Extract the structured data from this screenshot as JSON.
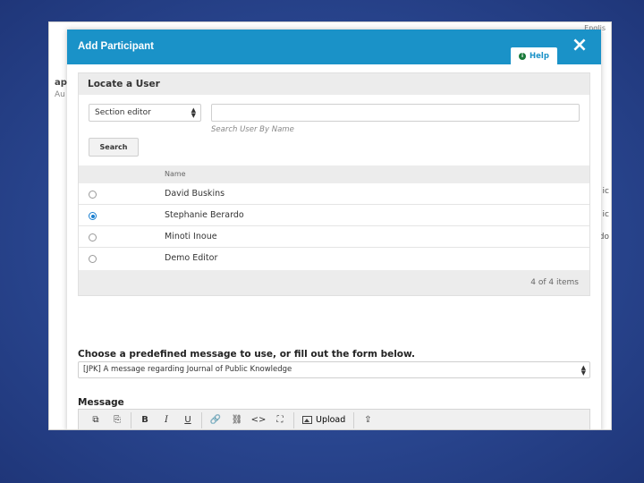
{
  "background_page": {
    "top_link": "Englis",
    "left_fragment_1": "ap",
    "left_fragment_2": "Au",
    "right_fragments": [
      "ic",
      "ic",
      "do"
    ]
  },
  "modal": {
    "title": "Add Participant",
    "help_label": "Help",
    "close_icon": "×"
  },
  "locate": {
    "heading": "Locate a User",
    "role_select_value": "Section editor",
    "search_input_value": "",
    "search_hint": "Search User By Name",
    "search_button": "Search",
    "column_header": "Name",
    "users": [
      {
        "name": "David Buskins",
        "selected": false
      },
      {
        "name": "Stephanie Berardo",
        "selected": true
      },
      {
        "name": "Minoti Inoue",
        "selected": false
      },
      {
        "name": "Demo Editor",
        "selected": false
      }
    ],
    "item_count": "4 of 4 items"
  },
  "message_form": {
    "predefined_label": "Choose a predefined message to use, or fill out the form below.",
    "predefined_value": "[JPK] A message regarding Journal of Public Knowledge",
    "message_label": "Message",
    "toolbar": {
      "copy": "⧉",
      "paste": "⎘",
      "bold": "B",
      "italic": "I",
      "underline": "U",
      "link": "🔗",
      "unlink": "⛓",
      "code": "<>",
      "fullscreen": "⛶",
      "upload": "Upload",
      "import": "⇪"
    }
  },
  "colors": {
    "header": "#1a92c8",
    "background": "#2c4a95"
  }
}
